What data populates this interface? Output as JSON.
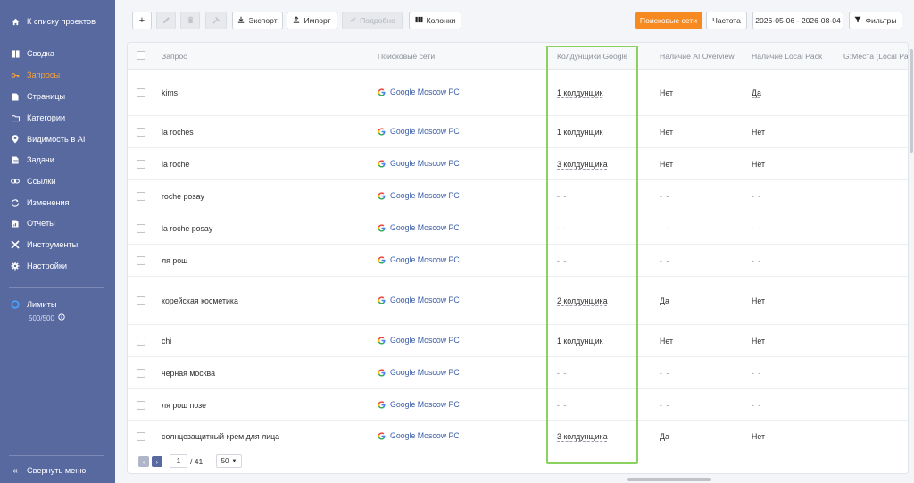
{
  "sidebar": {
    "back_label": "К списку проектов",
    "items": [
      {
        "label": "Сводка",
        "icon": "dashboard-icon"
      },
      {
        "label": "Запросы",
        "icon": "key-icon"
      },
      {
        "label": "Страницы",
        "icon": "page-icon"
      },
      {
        "label": "Категории",
        "icon": "folder-icon"
      },
      {
        "label": "Видимость в AI",
        "icon": "location-icon"
      },
      {
        "label": "Задачи",
        "icon": "task-icon"
      },
      {
        "label": "Ссылки",
        "icon": "link-icon"
      },
      {
        "label": "Изменения",
        "icon": "changes-icon"
      },
      {
        "label": "Отчеты",
        "icon": "report-icon"
      },
      {
        "label": "Инструменты",
        "icon": "tools-icon"
      },
      {
        "label": "Настройки",
        "icon": "gear-icon"
      }
    ],
    "active_index": 1,
    "limits_label": "Лимиты",
    "limits_value": "500/500",
    "collapse_label": "Свернуть меню",
    "active_color": "#f6a13a",
    "bg_color": "#5869a0"
  },
  "toolbar": {
    "add_label": "+",
    "export_label": "Экспорт",
    "import_label": "Импорт",
    "details_label": "Подробно",
    "columns_label": "Колонки",
    "engines_label": "Поисковые сети",
    "frequency_label": "Частота",
    "date_range": "2026-05-06 - 2026-08-04",
    "filters_label": "Фильтры",
    "accent_color": "#f6891f"
  },
  "table": {
    "columns": [
      "Запрос",
      "Поисковые сети",
      "Колдунщики Google",
      "Наличие AI Overview",
      "Наличие Local Pack",
      "G:Места (Local Pa"
    ],
    "rows": [
      {
        "query": "kims",
        "engine": "Google Moscow PC",
        "wizards": "1 колдунщик",
        "ai": "Нет",
        "local": "Да"
      },
      {
        "query": "la roches",
        "engine": "Google Moscow PC",
        "wizards": "1 колдунщик",
        "ai": "Нет",
        "local": "Нет"
      },
      {
        "query": "la roche",
        "engine": "Google Moscow PC",
        "wizards": "3 колдунщика",
        "ai": "Нет",
        "local": "Нет"
      },
      {
        "query": "roche posay",
        "engine": "Google Moscow PC",
        "wizards": "- -",
        "ai": "- -",
        "local": "- -"
      },
      {
        "query": "la roche posay",
        "engine": "Google Moscow PC",
        "wizards": "- -",
        "ai": "- -",
        "local": "- -"
      },
      {
        "query": "ля рош",
        "engine": "Google Moscow PC",
        "wizards": "- -",
        "ai": "- -",
        "local": "- -"
      },
      {
        "query": "корейская косметика",
        "engine": "Google Moscow PC",
        "wizards": "2 колдунщика",
        "ai": "Да",
        "local": "Нет"
      },
      {
        "query": "chi",
        "engine": "Google Moscow PC",
        "wizards": "1 колдунщик",
        "ai": "Нет",
        "local": "Нет"
      },
      {
        "query": "черная москва",
        "engine": "Google Moscow PC",
        "wizards": "- -",
        "ai": "- -",
        "local": "- -"
      },
      {
        "query": "ля рош позе",
        "engine": "Google Moscow PC",
        "wizards": "- -",
        "ai": "- -",
        "local": "- -"
      },
      {
        "query": "солнцезащитный крем для лица",
        "engine": "Google Moscow PC",
        "wizards": "3 колдунщика",
        "ai": "Да",
        "local": "Нет"
      }
    ]
  },
  "pager": {
    "current_page": "1",
    "total_pages": "/ 41",
    "per_page": "50"
  }
}
